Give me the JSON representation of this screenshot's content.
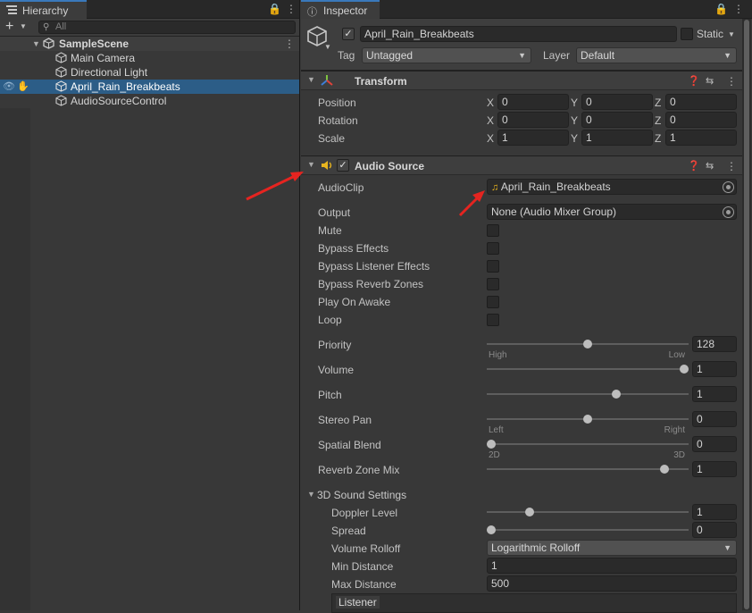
{
  "hierarchy": {
    "tab_label": "Hierarchy",
    "search_placeholder": "All",
    "scene": "SampleScene",
    "items": [
      {
        "label": "Main Camera"
      },
      {
        "label": "Directional Light"
      },
      {
        "label": "April_Rain_Breakbeats",
        "selected": true
      },
      {
        "label": "AudioSourceControl"
      }
    ]
  },
  "inspector": {
    "tab_label": "Inspector",
    "object_name": "April_Rain_Breakbeats",
    "static_label": "Static",
    "tag_label": "Tag",
    "tag_value": "Untagged",
    "layer_label": "Layer",
    "layer_value": "Default",
    "transform": {
      "title": "Transform",
      "rows": [
        {
          "label": "Position",
          "x": "0",
          "y": "0",
          "z": "0"
        },
        {
          "label": "Rotation",
          "x": "0",
          "y": "0",
          "z": "0"
        },
        {
          "label": "Scale",
          "x": "1",
          "y": "1",
          "z": "1"
        }
      ],
      "axes": {
        "x": "X",
        "y": "Y",
        "z": "Z"
      }
    },
    "audio_source": {
      "title": "Audio Source",
      "audioclip_label": "AudioClip",
      "audioclip_value": "April_Rain_Breakbeats",
      "output_label": "Output",
      "output_value": "None (Audio Mixer Group)",
      "toggles": [
        {
          "label": "Mute"
        },
        {
          "label": "Bypass Effects"
        },
        {
          "label": "Bypass Listener Effects"
        },
        {
          "label": "Bypass Reverb Zones"
        },
        {
          "label": "Play On Awake"
        },
        {
          "label": "Loop"
        }
      ],
      "sliders": [
        {
          "label": "Priority",
          "value": "128",
          "level": 0.5,
          "min_label": "High",
          "max_label": "Low"
        },
        {
          "label": "Volume",
          "value": "1",
          "level": 1.0,
          "min_label": "",
          "max_label": ""
        },
        {
          "label": "Pitch",
          "value": "1",
          "level": 0.65,
          "min_label": "",
          "max_label": ""
        },
        {
          "label": "Stereo Pan",
          "value": "0",
          "level": 0.5,
          "min_label": "Left",
          "max_label": "Right"
        },
        {
          "label": "Spatial Blend",
          "value": "0",
          "level": 0.0,
          "min_label": "2D",
          "max_label": "3D"
        },
        {
          "label": "Reverb Zone Mix",
          "value": "1",
          "level": 0.9,
          "min_label": "",
          "max_label": ""
        }
      ],
      "sound3d": {
        "title": "3D Sound Settings",
        "doppler_label": "Doppler Level",
        "doppler_value": "1",
        "doppler_level": 0.2,
        "spread_label": "Spread",
        "spread_value": "0",
        "spread_level": 0.0,
        "rolloff_label": "Volume Rolloff",
        "rolloff_value": "Logarithmic Rolloff",
        "min_label": "Min Distance",
        "min_value": "1",
        "max_label": "Max Distance",
        "max_value": "500",
        "listener_label": "Listener"
      }
    }
  },
  "colors": {
    "accent": "#3a79bb",
    "selection": "#2c5d87",
    "arrow": "#e52420"
  }
}
